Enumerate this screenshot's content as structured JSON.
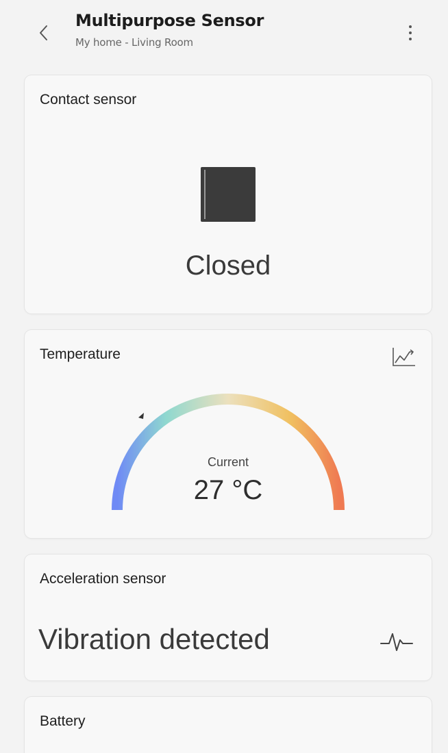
{
  "header": {
    "title": "Multipurpose Sensor",
    "subtitle": "My home - Living Room"
  },
  "contact": {
    "title": "Contact sensor",
    "state": "Closed"
  },
  "temperature": {
    "title": "Temperature",
    "label": "Current",
    "value": "27 °C",
    "gauge_colors": [
      "#6f8af5",
      "#8fd8cf",
      "#ece0bd",
      "#f0c060",
      "#ef7a52"
    ]
  },
  "acceleration": {
    "title": "Acceleration sensor",
    "state": "Vibration detected"
  },
  "battery": {
    "title": "Battery"
  },
  "icons": {
    "back": "chevron-left-icon",
    "more": "more-vertical-icon",
    "door": "door-closed-icon",
    "chart": "trend-chart-icon",
    "pulse": "vibration-pulse-icon"
  }
}
